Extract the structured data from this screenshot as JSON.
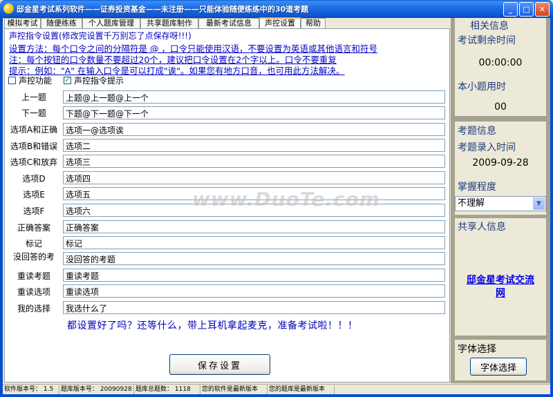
{
  "window": {
    "title": "邸金星考试系列软件——证券投资基金——未注册——只能体验随便练练中的30道考题"
  },
  "tabs": [
    "模拟考试",
    "随便练练",
    "个人题库管理",
    "共享题库制作",
    "最新考试信息",
    "声控设置",
    "帮助"
  ],
  "panel": {
    "header_note": "声控指令设置(修改完设置千万别忘了点保存呀!!!)",
    "instructions": [
      "设置方法：每个口令之间的分隔符是 @ ，口令只能使用汉语，不要设置为英语或其他语言和符号",
      "注：每个按钮的口令数量不要超过20个，建议把口令设置在2个字以上。口令不要重复",
      "提示：例如：\"A\" 在输入口令是可以打成\"诶\"。如果您有地方口音，也可用此方法解决。"
    ],
    "checkbox_voice": "声控功能",
    "checkbox_hint": "声控指令提示",
    "rows": [
      {
        "label": "上一题",
        "value": "上题@上一题@上一个"
      },
      {
        "label": "下一题",
        "value": "下题@下一题@下一个"
      },
      {
        "label": "选项A和正确",
        "value": "选项一@选项诶"
      },
      {
        "label": "选项B和错误",
        "value": "选项二"
      },
      {
        "label": "选项C和放弃",
        "value": "选项三"
      },
      {
        "label": "选项D",
        "value": "选项四"
      },
      {
        "label": "选项E",
        "value": "选项五"
      },
      {
        "label": "选项F",
        "value": "选项六"
      },
      {
        "label": "正确答案",
        "value": "正确答案"
      },
      {
        "label": "标记",
        "value": "标记"
      },
      {
        "label": "没回答的考",
        "value": "没回答的考题"
      },
      {
        "label": "重读考题",
        "value": "重读考题"
      },
      {
        "label": "重读选项",
        "value": "重读选项"
      },
      {
        "label": "我的选择",
        "value": "我选什么了"
      }
    ],
    "slogan": "都设置好了吗？还等什么，带上耳机拿起麦克，准备考试啦！！！",
    "save_button": "保存设置"
  },
  "watermark": "www.DuoTe.com",
  "sidebar": {
    "related_info": "相关信息",
    "time_left_title": "考试剩余时间",
    "time_left_value": "00:00:00",
    "question_time_title": "本小题用时",
    "question_time_value": "00",
    "question_info_title": "考题信息",
    "entry_time_title": "考题录入时间",
    "entry_time_value": "2009-09-28",
    "mastery_title": "掌握程度",
    "mastery_value": "不理解",
    "sharer_title": "共享人信息",
    "link_line1": "邸金星考试交流",
    "link_line2": "网",
    "font_title": "字体选择",
    "font_button": "字体选择"
  },
  "statusbar": {
    "software_version": "软件版本号： 1.5",
    "db_version": "题库版本号： 20090928",
    "total_questions": "题库总题数： 1118",
    "software_latest": "您的软件是最新版本",
    "db_latest": "您的题库是最新版本"
  }
}
